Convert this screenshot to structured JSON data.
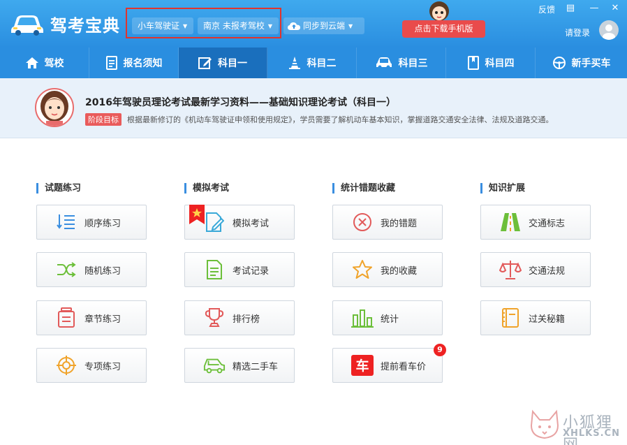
{
  "app": {
    "title": "驾考宝典"
  },
  "header": {
    "license_dropdown": "小车驾驶证",
    "school_dropdown": "南京 未报考驾校",
    "sync_button": "同步到云端",
    "download_button": "点击下载手机版",
    "feedback": "反馈",
    "login": "请登录",
    "window_controls": {
      "menu": "▤",
      "minimize": "—",
      "close": "✕"
    }
  },
  "nav": {
    "items": [
      {
        "label": "驾校",
        "icon": "home-icon"
      },
      {
        "label": "报名须知",
        "icon": "document-icon"
      },
      {
        "label": "科目一",
        "icon": "edit-icon",
        "active": true
      },
      {
        "label": "科目二",
        "icon": "cone-icon"
      },
      {
        "label": "科目三",
        "icon": "car-icon"
      },
      {
        "label": "科目四",
        "icon": "book-icon"
      },
      {
        "label": "新手买车",
        "icon": "steering-wheel-icon"
      }
    ]
  },
  "banner": {
    "title": "2016年驾驶员理论考试最新学习资料——基础知识理论考试（科目一）",
    "tag": "阶段目标",
    "description": "根据最新修订的《机动车驾驶证申领和使用规定》，学员需要了解机动车基本知识，掌握道路交通安全法律、法规及道路交通。"
  },
  "sections": [
    {
      "title": "试题练习",
      "items": [
        "顺序练习",
        "随机练习",
        "章节练习",
        "专项练习"
      ]
    },
    {
      "title": "模拟考试",
      "items": [
        "模拟考试",
        "考试记录",
        "排行榜",
        "精选二手车"
      ]
    },
    {
      "title": "统计错题收藏",
      "items": [
        "我的错题",
        "我的收藏",
        "统计",
        "提前看车价"
      ]
    },
    {
      "title": "知识扩展",
      "items": [
        "交通标志",
        "交通法规",
        "过关秘籍"
      ]
    }
  ],
  "badges": {
    "car_price": "9"
  },
  "car_price_icon_char": "车",
  "watermark": {
    "line1": "小狐狸网",
    "line2": "XHLKS.CN"
  },
  "colors": {
    "header_blue": "#2a8ee0",
    "active_nav": "#1a6fbd",
    "download_red": "#e94b4b",
    "badge_red": "#e22222"
  }
}
